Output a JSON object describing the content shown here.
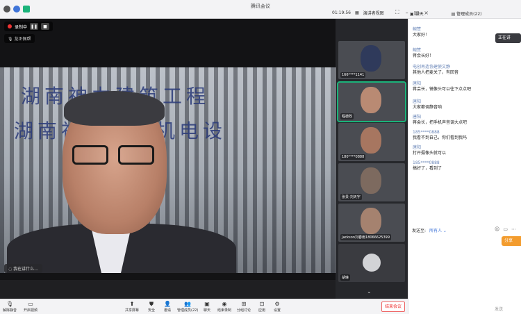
{
  "window": {
    "title": "腾讯会议"
  },
  "topbar": {
    "timer": "01:19:56",
    "view_label": "演讲者视图",
    "chat_tab": "聊天",
    "members_tab": "管理成员(22)"
  },
  "main_video": {
    "recording_label": "录制中",
    "speaker_label": "龙正佩帮",
    "name_badge": "我在讲什么...",
    "wall_text_top": "湖南神力建筑工程",
    "wall_text_bottom": "湖南神力建筑机电设"
  },
  "participants": [
    {
      "label": "166****1141"
    },
    {
      "label": "程德政"
    },
    {
      "label": "180****0888"
    },
    {
      "label": "张贵-刘天宇"
    },
    {
      "label": "Jackson刘春雨18066625399"
    },
    {
      "label": "胡琳"
    }
  ],
  "toolbar": {
    "mute_label": "解除静音",
    "video_label": "开启视频",
    "items": [
      {
        "label": "共享屏幕"
      },
      {
        "label": "安全"
      },
      {
        "label": "邀请"
      },
      {
        "label": "管理成员(22)"
      },
      {
        "label": "聊天"
      },
      {
        "label": "结束录制"
      },
      {
        "label": "分组讨论"
      },
      {
        "label": "应用"
      },
      {
        "label": "设置"
      }
    ],
    "leave_label": "结束会议"
  },
  "chat": {
    "float_label": "正在讲",
    "messages": [
      {
        "sender": "鲍赞",
        "text": "大家好！"
      },
      {
        "sender": "鲍赞",
        "text": "蒋会长好！"
      },
      {
        "sender": "电创再造协建使文静",
        "text": "其他人把麦关了，有回音"
      },
      {
        "sender": "唐阳",
        "text": "蒋会长，镜像头可以往下点点吧"
      },
      {
        "sender": "唐阳",
        "text": "大家都调静音响"
      },
      {
        "sender": "唐阳",
        "text": "蒋会长，把手机声音调大点吧"
      },
      {
        "sender": "185****0888",
        "text": "我看不到自己，你们看到我吗"
      },
      {
        "sender": "唐阳",
        "text": "打开摄像头就可以"
      },
      {
        "sender": "185****0888",
        "text": "搞好了，看到了"
      }
    ],
    "send_to_label": "发送至:",
    "send_to_target": "所有人",
    "orange_tag": "分享",
    "send_button": "发送"
  },
  "colors": {
    "accent": "#1bb37a",
    "link": "#3f74d8",
    "sender": "#6a86b8",
    "danger": "#e33333"
  }
}
